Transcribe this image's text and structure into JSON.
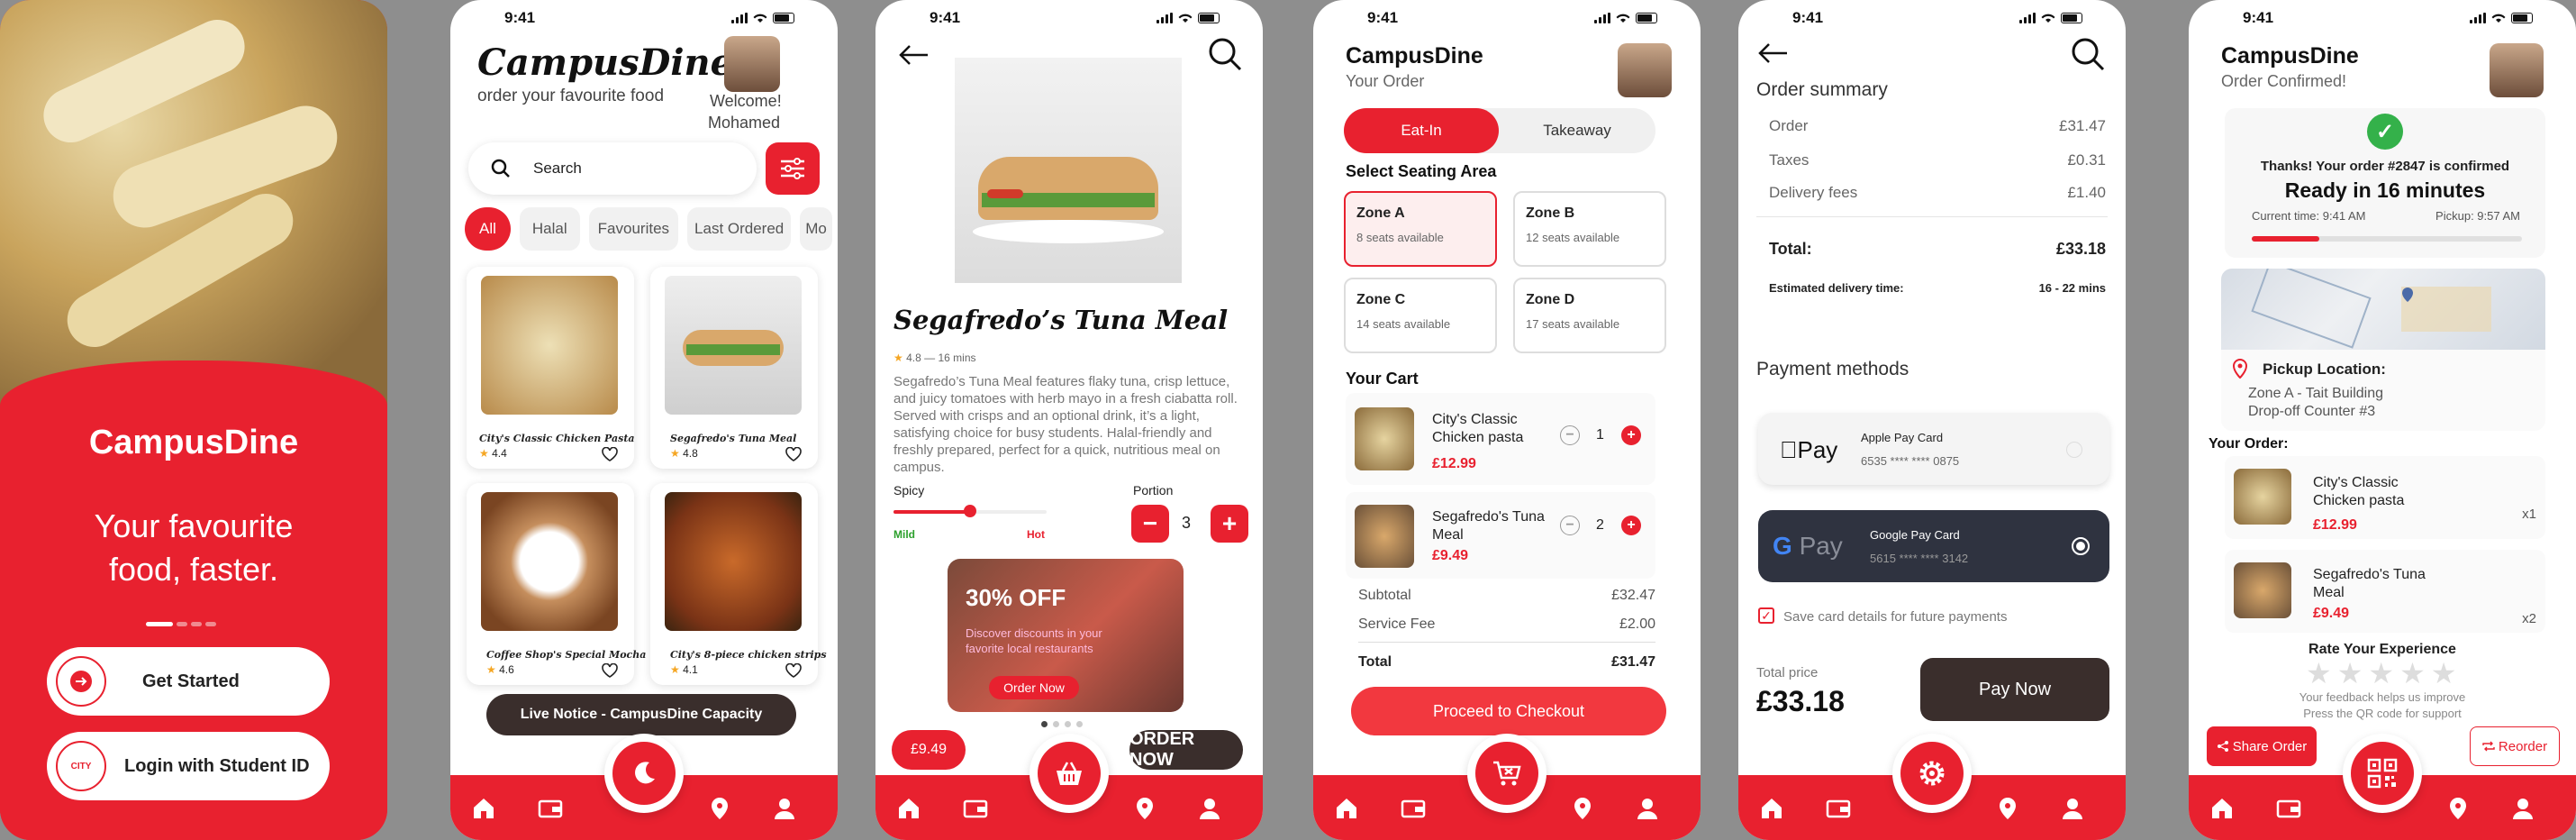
{
  "status_time": "9:41",
  "colors": {
    "brand": "#e8212f",
    "dark": "#3a2e2c"
  },
  "screen1": {
    "app_name": "CampusDine",
    "tagline": "Your favourite food, faster.",
    "get_started": "Get Started",
    "login_student": "Login with Student ID",
    "city_logo_text": "CITY"
  },
  "screen2": {
    "logo": "CampusDine",
    "subtitle": "order your favourite food",
    "welcome": "Welcome!",
    "user": "Mohamed",
    "search_placeholder": "Search",
    "chips": [
      "All",
      "Halal",
      "Favourites",
      "Last Ordered",
      "Mo"
    ],
    "items": [
      {
        "name": "City's Classic Chicken Pasta",
        "rating": "4.4"
      },
      {
        "name": "Segafredo's Tuna Meal",
        "rating": "4.8"
      },
      {
        "name": "Coffee Shop's Special Mocha",
        "rating": "4.6"
      },
      {
        "name": "City's 8-piece chicken strips",
        "rating": "4.1"
      }
    ],
    "notice": "Live Notice - CampusDine Capacity"
  },
  "screen3": {
    "title": "Segafredo’s Tuna Meal",
    "rating": "4.8",
    "time": "16 mins",
    "description": "Segafredo’s Tuna Meal features flaky tuna, crisp lettuce, and juicy tomatoes with herb mayo in a fresh ciabatta roll. Served with crisps and an optional drink, it’s a light, satisfying choice for busy students. Halal-friendly and freshly prepared, perfect for a quick, nutritious meal on campus.",
    "spicy_label": "Spicy",
    "mild": "Mild",
    "hot": "Hot",
    "spice_level": 0.5,
    "portion_label": "Portion",
    "portion_value": "3",
    "promo_title": "30% OFF",
    "promo_text": "Discover discounts in your favorite local restaurants",
    "promo_button": "Order Now",
    "price": "£9.49",
    "order_now": "ORDER NOW"
  },
  "screen4": {
    "app_name": "CampusDine",
    "subtitle": "Your Order",
    "tab_eatin": "Eat-In",
    "tab_takeaway": "Takeaway",
    "seating_heading": "Select Seating Area",
    "zones": [
      {
        "name": "Zone A",
        "seats": "8 seats available"
      },
      {
        "name": "Zone B",
        "seats": "12 seats available"
      },
      {
        "name": "Zone C",
        "seats": "14 seats available"
      },
      {
        "name": "Zone D",
        "seats": "17 seats available"
      }
    ],
    "cart_heading": "Your Cart",
    "cart": [
      {
        "name": "City's Classic Chicken pasta",
        "price": "£12.99",
        "qty": "1"
      },
      {
        "name": "Segafredo's Tuna Meal",
        "price": "£9.49",
        "qty": "2"
      }
    ],
    "subtotal_label": "Subtotal",
    "subtotal": "£32.47",
    "fee_label": "Service Fee",
    "fee": "£2.00",
    "total_label": "Total",
    "total": "£31.47",
    "checkout": "Proceed to Checkout"
  },
  "screen5": {
    "heading": "Order summary",
    "order_label": "Order",
    "order": "£31.47",
    "taxes_label": "Taxes",
    "taxes": "£0.31",
    "delivery_label": "Delivery fees",
    "delivery": "£1.40",
    "total_label": "Total:",
    "total": "£33.18",
    "eta_label": "Estimated delivery time:",
    "eta": "16 - 22 mins",
    "payment_heading": "Payment methods",
    "apple_pay": "Pay",
    "apple_card_name": "Apple Pay Card",
    "apple_card_num": "6535 **** **** 0875",
    "google_pay": "Pay",
    "google_card_name": "Google Pay Card",
    "google_card_num": "5615 **** **** 3142",
    "save_card": "Save card details for future payments",
    "total_price_label": "Total price",
    "total_price": "£33.18",
    "pay_now": "Pay Now"
  },
  "screen6": {
    "app_name": "CampusDine",
    "subtitle": "Order Confirmed!",
    "thanks": "Thanks! Your order #2847 is confirmed",
    "ready": "Ready in 16 minutes",
    "current_time": "Current time: 9:41 AM",
    "pickup_time": "Pickup: 9:57 AM",
    "progress": 0.25,
    "pickup_heading": "Pickup Location:",
    "pickup_line1": "Zone A - Tait Building",
    "pickup_line2": "Drop-off Counter #3",
    "your_order": "Your Order:",
    "items": [
      {
        "name": "City's Classic Chicken pasta",
        "price": "£12.99",
        "qty": "x1"
      },
      {
        "name": "Segafredo's Tuna Meal",
        "price": "£9.49",
        "qty": "x2"
      }
    ],
    "rate_heading": "Rate Your Experience",
    "rate_line1": "Your feedback helps us improve",
    "rate_line2": "Press the QR code for support",
    "share": "Share Order",
    "reorder": "Reorder"
  }
}
